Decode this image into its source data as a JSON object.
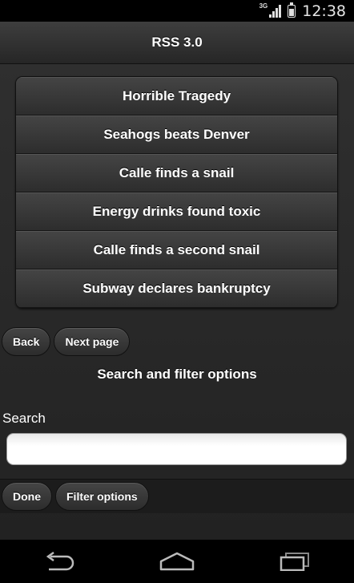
{
  "status_bar": {
    "network": "3G",
    "time": "12:38",
    "icons": [
      "signal-icon",
      "battery-icon"
    ]
  },
  "header": {
    "title": "RSS 3.0"
  },
  "feed": {
    "items": [
      "Horrible Tragedy",
      "Seahogs beats Denver",
      "Calle finds a snail",
      "Energy drinks found toxic",
      "Calle finds a second snail",
      "Subway declares bankruptcy"
    ]
  },
  "pager": {
    "back_label": "Back",
    "next_label": "Next page"
  },
  "search_section": {
    "title": "Search and filter options",
    "search_label": "Search",
    "search_value": "",
    "search_placeholder": ""
  },
  "footer": {
    "done_label": "Done",
    "filter_label": "Filter options"
  },
  "nav_bar": {
    "icons": [
      "back-icon",
      "home-icon",
      "recent-apps-icon"
    ]
  },
  "colors": {
    "background": "#2a2a2a",
    "bar": "#000000",
    "text": "#ffffff"
  }
}
